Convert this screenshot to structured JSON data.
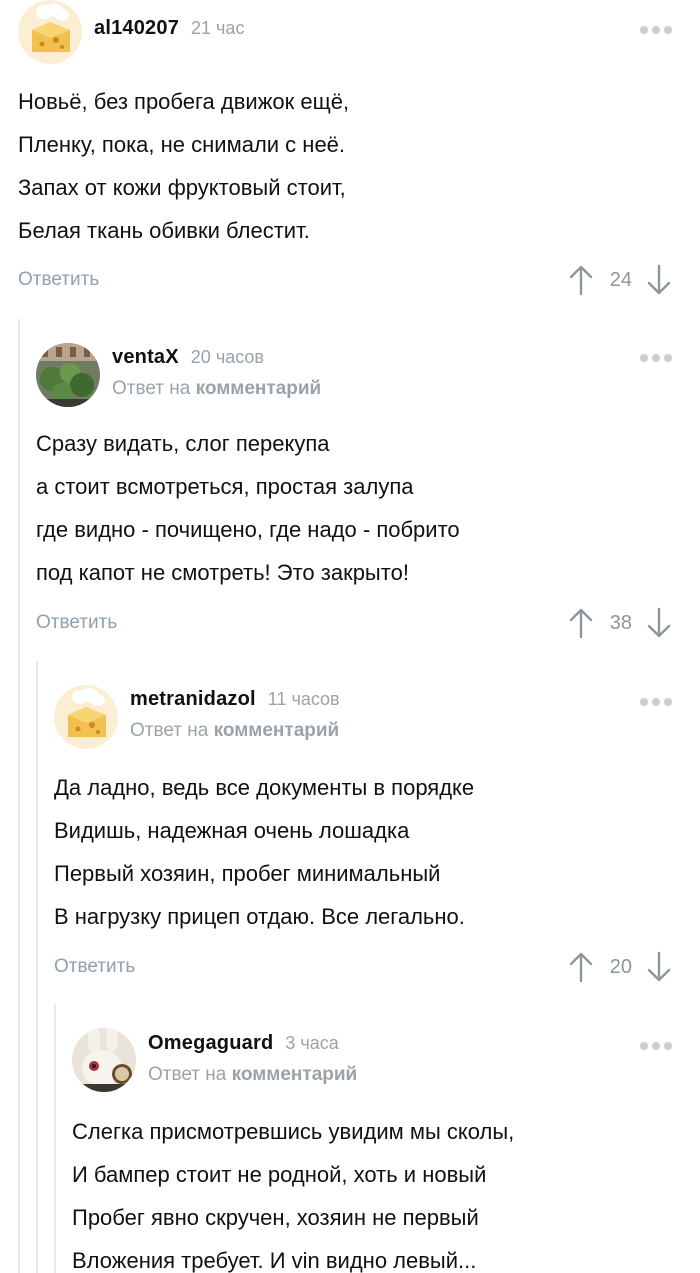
{
  "comments": [
    {
      "author": "al140207",
      "time": "21 час",
      "reply_to": "",
      "lines": [
        "Новьё, без пробега движок ещё,",
        "Пленку, пока, не снимали с неё.",
        "Запах от кожи фруктовый стоит,",
        "Белая ткань обивки блестит."
      ],
      "reply_label": "Ответить",
      "rating": "24"
    },
    {
      "author": "ventaX",
      "time": "20 часов",
      "reply_to_prefix": "Ответ на",
      "reply_to_link": "комментарий",
      "lines": [
        "Сразу видать, слог перекупа",
        "а стоит всмотреться, простая залупа",
        "где видно - почищено, где надо - побрито",
        "под капот не смотреть! Это закрыто!"
      ],
      "reply_label": "Ответить",
      "rating": "38"
    },
    {
      "author": "metranidazol",
      "time": "11 часов",
      "reply_to_prefix": "Ответ на",
      "reply_to_link": "комментарий",
      "lines": [
        "Да ладно, ведь все документы в порядке",
        "Видишь, надежная очень лошадка",
        "Первый хозяин, пробег минимальный",
        "В нагрузку прицеп отдаю. Все легально."
      ],
      "reply_label": "Ответить",
      "rating": "20"
    },
    {
      "author": "Omegaguard",
      "time": "3 часа",
      "reply_to_prefix": "Ответ на",
      "reply_to_link": "комментарий",
      "lines": [
        "Слегка присмотревшись увидим мы сколы,",
        "И бампер стоит не родной, хоть и новый",
        "Пробег явно скручен, хозяин не первый",
        "Вложения требует. И vin видно левый..."
      ]
    }
  ],
  "colors": {
    "muted": "#9aa3a9",
    "reply": "#8ea1ad",
    "rail": "#e6e8ea",
    "text": "#111111"
  },
  "icons": {
    "avatar_default": "chef-hat-avatar",
    "more": "more-dots-icon",
    "up": "arrow-up-icon",
    "down": "arrow-down-icon"
  }
}
